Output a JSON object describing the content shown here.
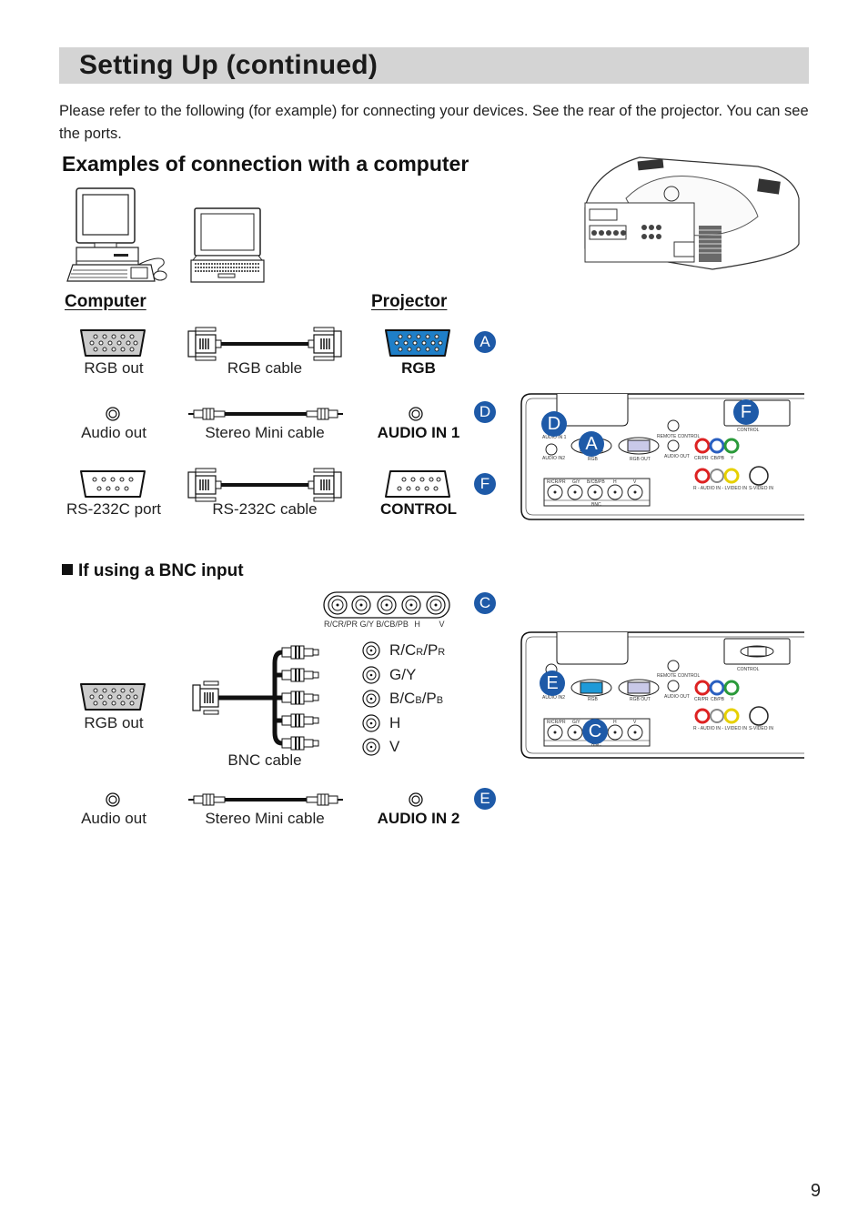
{
  "header": {
    "title": "Setting Up (continued)"
  },
  "intro": "Please refer to the following (for example) for connecting your devices. See the rear of the projector. You can see the ports.",
  "section": {
    "title": "Examples of connection with a computer",
    "columns": {
      "computer": "Computer",
      "projector": "Projector"
    }
  },
  "connections": [
    {
      "marker": "A",
      "computer_port": "RGB out",
      "cable": "RGB cable",
      "projector_port": "RGB"
    },
    {
      "marker": "D",
      "computer_port": "Audio out",
      "cable": "Stereo Mini cable",
      "projector_port": "AUDIO IN 1"
    },
    {
      "marker": "F",
      "computer_port": "RS-232C port",
      "cable": "RS-232C cable",
      "projector_port": "CONTROL"
    }
  ],
  "bnc_section": {
    "title": "If using a BNC input",
    "marker": "C",
    "strip_labels": [
      "R/CR/PR",
      "G/Y",
      "B/CB/PB",
      "H",
      "V"
    ],
    "computer_port": "RGB out",
    "cable": "BNC cable",
    "outputs": [
      {
        "main": "R/C",
        "sub1": "R",
        "mid": "/P",
        "sub2": "R"
      },
      {
        "main": "G/Y",
        "sub1": "",
        "mid": "",
        "sub2": ""
      },
      {
        "main": "B/C",
        "sub1": "B",
        "mid": "/P",
        "sub2": "B"
      },
      {
        "main": "H",
        "sub1": "",
        "mid": "",
        "sub2": ""
      },
      {
        "main": "V",
        "sub1": "",
        "mid": "",
        "sub2": ""
      }
    ],
    "audio": {
      "marker": "E",
      "computer_port": "Audio out",
      "cable": "Stereo Mini cable",
      "projector_port": "AUDIO IN 2"
    }
  },
  "rear_panel": {
    "labels": {
      "audio_in1": "AUDIO IN 1",
      "audio_in2": "AUDIO IN2",
      "rgb": "RGB",
      "rgb_out": "RGB OUT",
      "remote_control": "REMOTE CONTROL",
      "audio_out": "AUDIO OUT",
      "control": "CONTROL",
      "cr_pr": "CR/PR",
      "cb_pb": "CB/PB",
      "y": "Y",
      "audio_in_lr": "R - AUDIO IN - L",
      "video_in": "VIDEO IN",
      "s_video_in": "S-VIDEO IN",
      "bnc": "BNC",
      "bnc_ports": [
        "R/CR/PR",
        "G/Y",
        "B/CB/PB",
        "H",
        "V"
      ]
    },
    "panel1_markers": [
      "D",
      "A",
      "F"
    ],
    "panel2_markers": [
      "E",
      "C"
    ]
  },
  "colors": {
    "marker": "#1e5aa8",
    "title_bar": "#d4d4d4",
    "rgb_port": "#1f7fc8"
  },
  "page_number": "9"
}
